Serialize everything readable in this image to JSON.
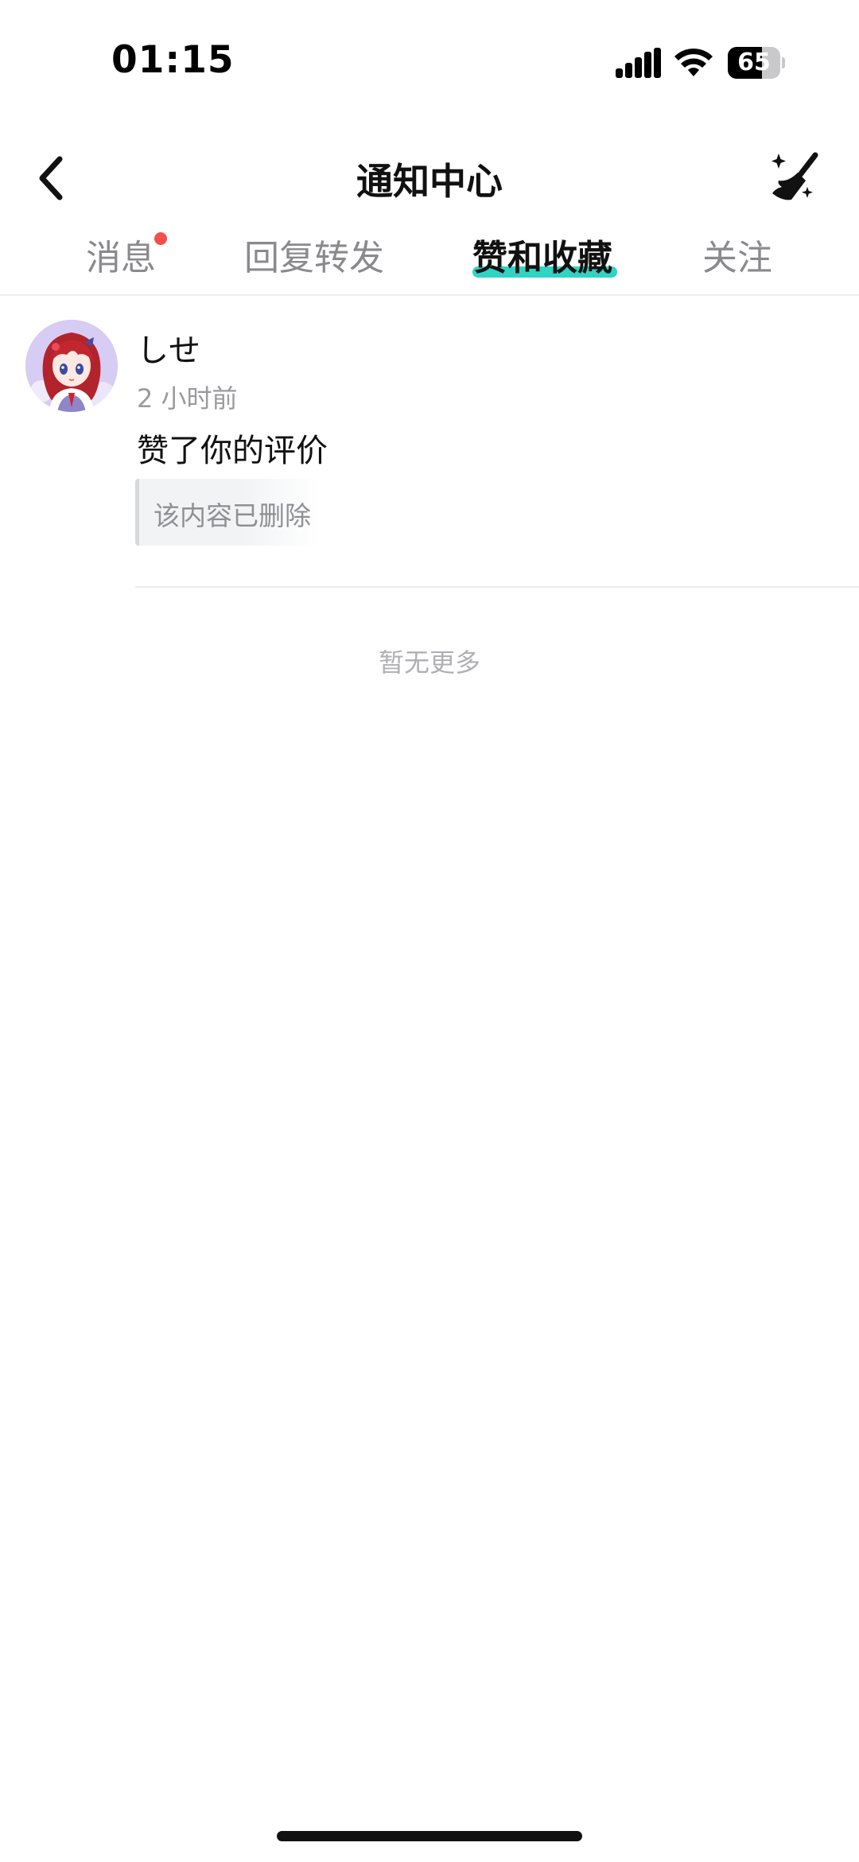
{
  "status_bar": {
    "time": "01:15",
    "battery": "65",
    "battery_level": 0.65
  },
  "nav": {
    "title": "通知中心"
  },
  "tabs": [
    {
      "label": "消息",
      "active": false,
      "has_dot": true
    },
    {
      "label": "回复转发",
      "active": false
    },
    {
      "label": "赞和收藏",
      "active": true
    },
    {
      "label": "关注",
      "active": false
    }
  ],
  "notifications": [
    {
      "username": "しせ",
      "time": "2 小时前",
      "action": "赞了你的评价",
      "quoted": "该内容已删除"
    }
  ],
  "footer": {
    "end_text": "暂无更多"
  },
  "colors": {
    "accent_underline": "#2fd4c4",
    "badge_dot": "#f2504b"
  }
}
